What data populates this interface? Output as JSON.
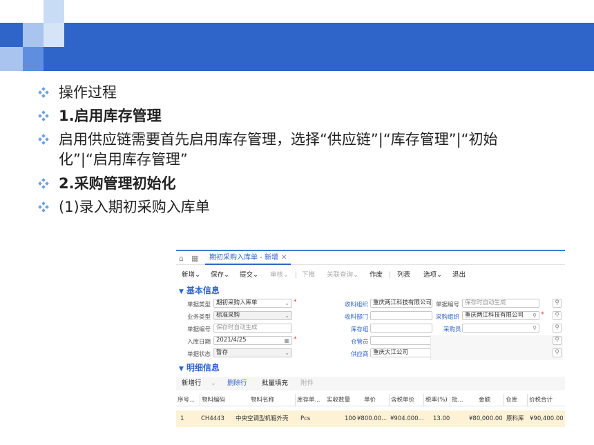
{
  "bullets": [
    {
      "text": "操作过程",
      "bold": false
    },
    {
      "text": "1.启用库存管理",
      "bold": true
    },
    {
      "text_line1": "启用供应链需要首先启用库存管理，选择“供应链”|“库存管理”|“初始",
      "text_line2": "化”|“启用库存管理”",
      "bold": false
    },
    {
      "text": "2.采购管理初始化",
      "bold": true
    },
    {
      "text": "(1)录入期初采购入库单",
      "bold": false
    }
  ],
  "bullet_icon": "diamond-bullet-icon",
  "colors": {
    "header_blue": "#2f64c8",
    "bullet": "#6fa0e0",
    "row_highlight": "#fdf2d6"
  },
  "app": {
    "tab_title": "期初采购入库单 - 新增",
    "toolbar": {
      "new": "新增",
      "save": "保存",
      "submit": "提交",
      "audit": "审核",
      "push": "下推",
      "related": "关联查询",
      "void": "作废",
      "list": "列表",
      "options": "选项",
      "exit": "退出"
    },
    "basic_section": "基本信息",
    "fields": {
      "doc_type_label": "单据类型",
      "doc_type_value": "期初采购入库单",
      "biz_type_label": "业务类型",
      "biz_type_value": "标准采购",
      "doc_no_label": "单据编号",
      "doc_no_placeholder": "保存时自动生成",
      "date_label": "入库日期",
      "date_value": "2021/4/25",
      "status_label": "单据状态",
      "status_value": "暂存",
      "recv_org_label": "收料组织",
      "recv_org_value": "重庆两江科技有限公司",
      "recv_dept_label": "收料部门",
      "stock_group_label": "库存组",
      "keeper_label": "仓管员",
      "supplier_label": "供应商",
      "supplier_value": "重庆大江公司",
      "doc_no2_label": "单据编号",
      "doc_no2_placeholder": "保存时自动生成",
      "purchase_org_label": "采购组织",
      "purchase_org_value": "重庆两江科技有限公司",
      "buyer_label": "采购员"
    },
    "detail_section": "明细信息",
    "detail_tools": {
      "add_row": "新增行",
      "delete_row": "删除行",
      "batch_fill": "批量填充",
      "attachment": "附件"
    },
    "columns": [
      "序号...",
      "物料编码",
      "物料名称",
      "库存单...",
      "实收数量",
      "单价",
      "含税单价",
      "税率(%)",
      "批...",
      "金额",
      "仓库",
      "价税合计"
    ],
    "rows": [
      [
        "1",
        "CH4443",
        "中央空调型机箱外壳",
        "Pcs",
        "100",
        "¥800.00...",
        "¥904.000...",
        "13.00",
        "",
        "¥80,000.00",
        "原料库",
        "¥90,400.00"
      ]
    ]
  }
}
